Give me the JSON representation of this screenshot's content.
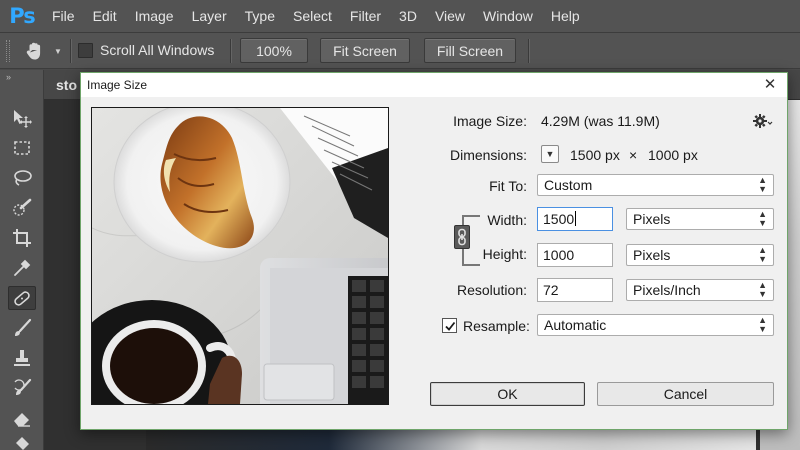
{
  "app": {
    "logo": "Ps"
  },
  "menu": [
    "File",
    "Edit",
    "Image",
    "Layer",
    "Type",
    "Select",
    "Filter",
    "3D",
    "View",
    "Window",
    "Help"
  ],
  "options": {
    "scroll_all_windows": "Scroll All Windows",
    "btn_100": "100%",
    "btn_fit": "Fit Screen",
    "btn_fill": "Fill Screen"
  },
  "document": {
    "tab_label": "sto"
  },
  "dialog": {
    "title": "Image Size",
    "image_size_label": "Image Size:",
    "image_size_value": "4.29M (was 11.9M)",
    "dimensions_label": "Dimensions:",
    "dimensions_w": "1500 px",
    "dimensions_x": "×",
    "dimensions_h": "1000 px",
    "fit_to_label": "Fit To:",
    "fit_to_value": "Custom",
    "width_label": "Width:",
    "width_value": "1500",
    "width_unit": "Pixels",
    "height_label": "Height:",
    "height_value": "1000",
    "height_unit": "Pixels",
    "resolution_label": "Resolution:",
    "resolution_value": "72",
    "resolution_unit": "Pixels/Inch",
    "resample_label": "Resample:",
    "resample_value": "Automatic",
    "resample_checked": true,
    "ok_label": "OK",
    "cancel_label": "Cancel"
  },
  "icons": {
    "close": "close-icon",
    "gear": "gear-icon",
    "chain": "link-icon"
  },
  "colors": {
    "ps_blue": "#31a8ff",
    "dialog_bg": "#f0f0f0",
    "dialog_border": "#6fa56a",
    "focus_blue": "#4a90e2"
  }
}
